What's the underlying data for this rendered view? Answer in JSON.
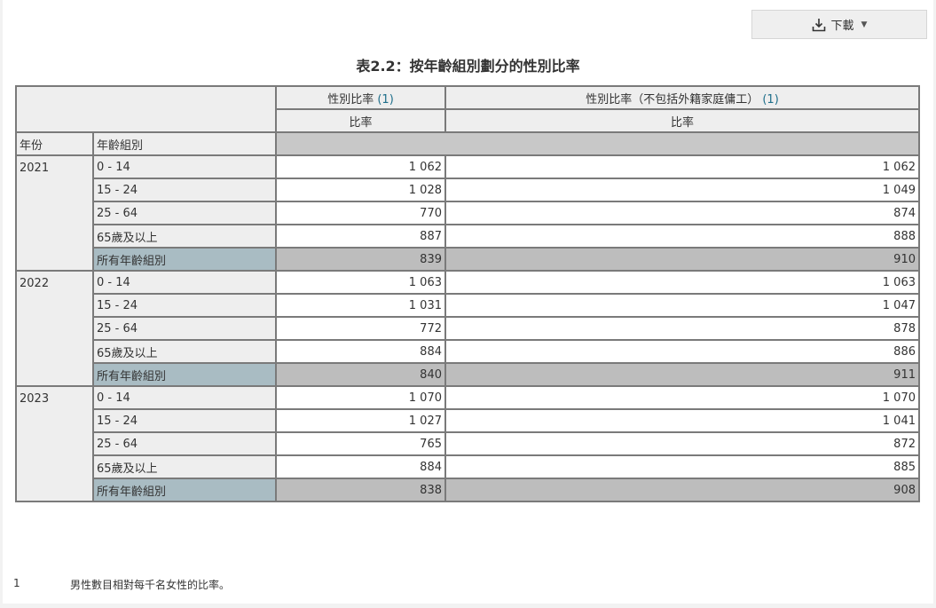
{
  "toolbar": {
    "download_label": "下載",
    "download_icon": "download-icon"
  },
  "table_title": "表2.2：按年齡組別劃分的性別比率",
  "columns": {
    "col1": {
      "label": "性別比率",
      "note": "(1)",
      "sub": "比率"
    },
    "col2": {
      "label": "性別比率（不包括外籍家庭傭工）",
      "note": "(1)",
      "sub": "比率"
    }
  },
  "row_headers": {
    "year": "年份",
    "age_group": "年齡組別"
  },
  "groups": [
    {
      "year": "2021",
      "rows": [
        {
          "age": "0 - 14",
          "v1": "1 062",
          "v2": "1 062"
        },
        {
          "age": "15 - 24",
          "v1": "1 028",
          "v2": "1 049"
        },
        {
          "age": "25 - 64",
          "v1": "770",
          "v2": "874"
        },
        {
          "age": "65歲及以上",
          "v1": "887",
          "v2": "888"
        },
        {
          "age": "所有年齡組別",
          "v1": "839",
          "v2": "910"
        }
      ]
    },
    {
      "year": "2022",
      "rows": [
        {
          "age": "0 - 14",
          "v1": "1 063",
          "v2": "1 063"
        },
        {
          "age": "15 - 24",
          "v1": "1 031",
          "v2": "1 047"
        },
        {
          "age": "25 - 64",
          "v1": "772",
          "v2": "878"
        },
        {
          "age": "65歲及以上",
          "v1": "884",
          "v2": "886"
        },
        {
          "age": "所有年齡組別",
          "v1": "840",
          "v2": "911"
        }
      ]
    },
    {
      "year": "2023",
      "rows": [
        {
          "age": "0 - 14",
          "v1": "1 070",
          "v2": "1 070"
        },
        {
          "age": "15 - 24",
          "v1": "1 027",
          "v2": "1 041"
        },
        {
          "age": "25 - 64",
          "v1": "765",
          "v2": "872"
        },
        {
          "age": "65歲及以上",
          "v1": "884",
          "v2": "885"
        },
        {
          "age": "所有年齡組別",
          "v1": "838",
          "v2": "908"
        }
      ]
    }
  ],
  "footnote": {
    "number": "1",
    "text": "男性數目相對每千名女性的比率。"
  }
}
